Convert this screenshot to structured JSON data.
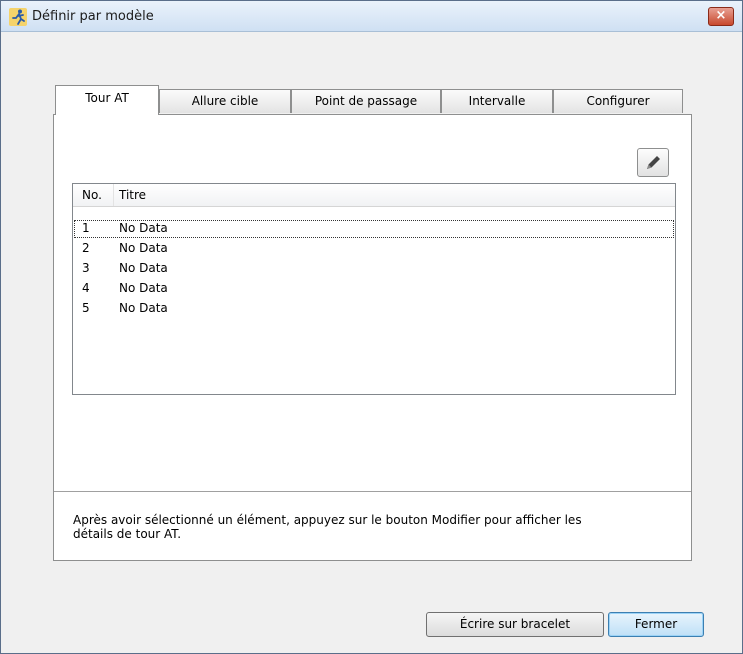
{
  "window": {
    "title": "Définir par modèle",
    "close_symbol": "×",
    "app_icon": "runner-icon"
  },
  "tabs": [
    {
      "label": "Tour AT",
      "active": true
    },
    {
      "label": "Allure cible",
      "active": false
    },
    {
      "label": "Point de passage",
      "active": false
    },
    {
      "label": "Intervalle",
      "active": false
    },
    {
      "label": "Configurer",
      "active": false
    }
  ],
  "toolbar": {
    "edit_icon": "pencil-icon"
  },
  "list": {
    "columns": [
      "No.",
      "Titre"
    ],
    "rows": [
      {
        "no": "1",
        "title": "No Data"
      },
      {
        "no": "2",
        "title": "No Data"
      },
      {
        "no": "3",
        "title": "No Data"
      },
      {
        "no": "4",
        "title": "No Data"
      },
      {
        "no": "5",
        "title": "No Data"
      }
    ]
  },
  "hint": {
    "line1": "Après avoir sélectionné un élément, appuyez sur le bouton Modifier pour afficher les",
    "line2": "détails de tour AT."
  },
  "footer": {
    "write_label": "Écrire sur bracelet",
    "close_label": "Fermer"
  }
}
